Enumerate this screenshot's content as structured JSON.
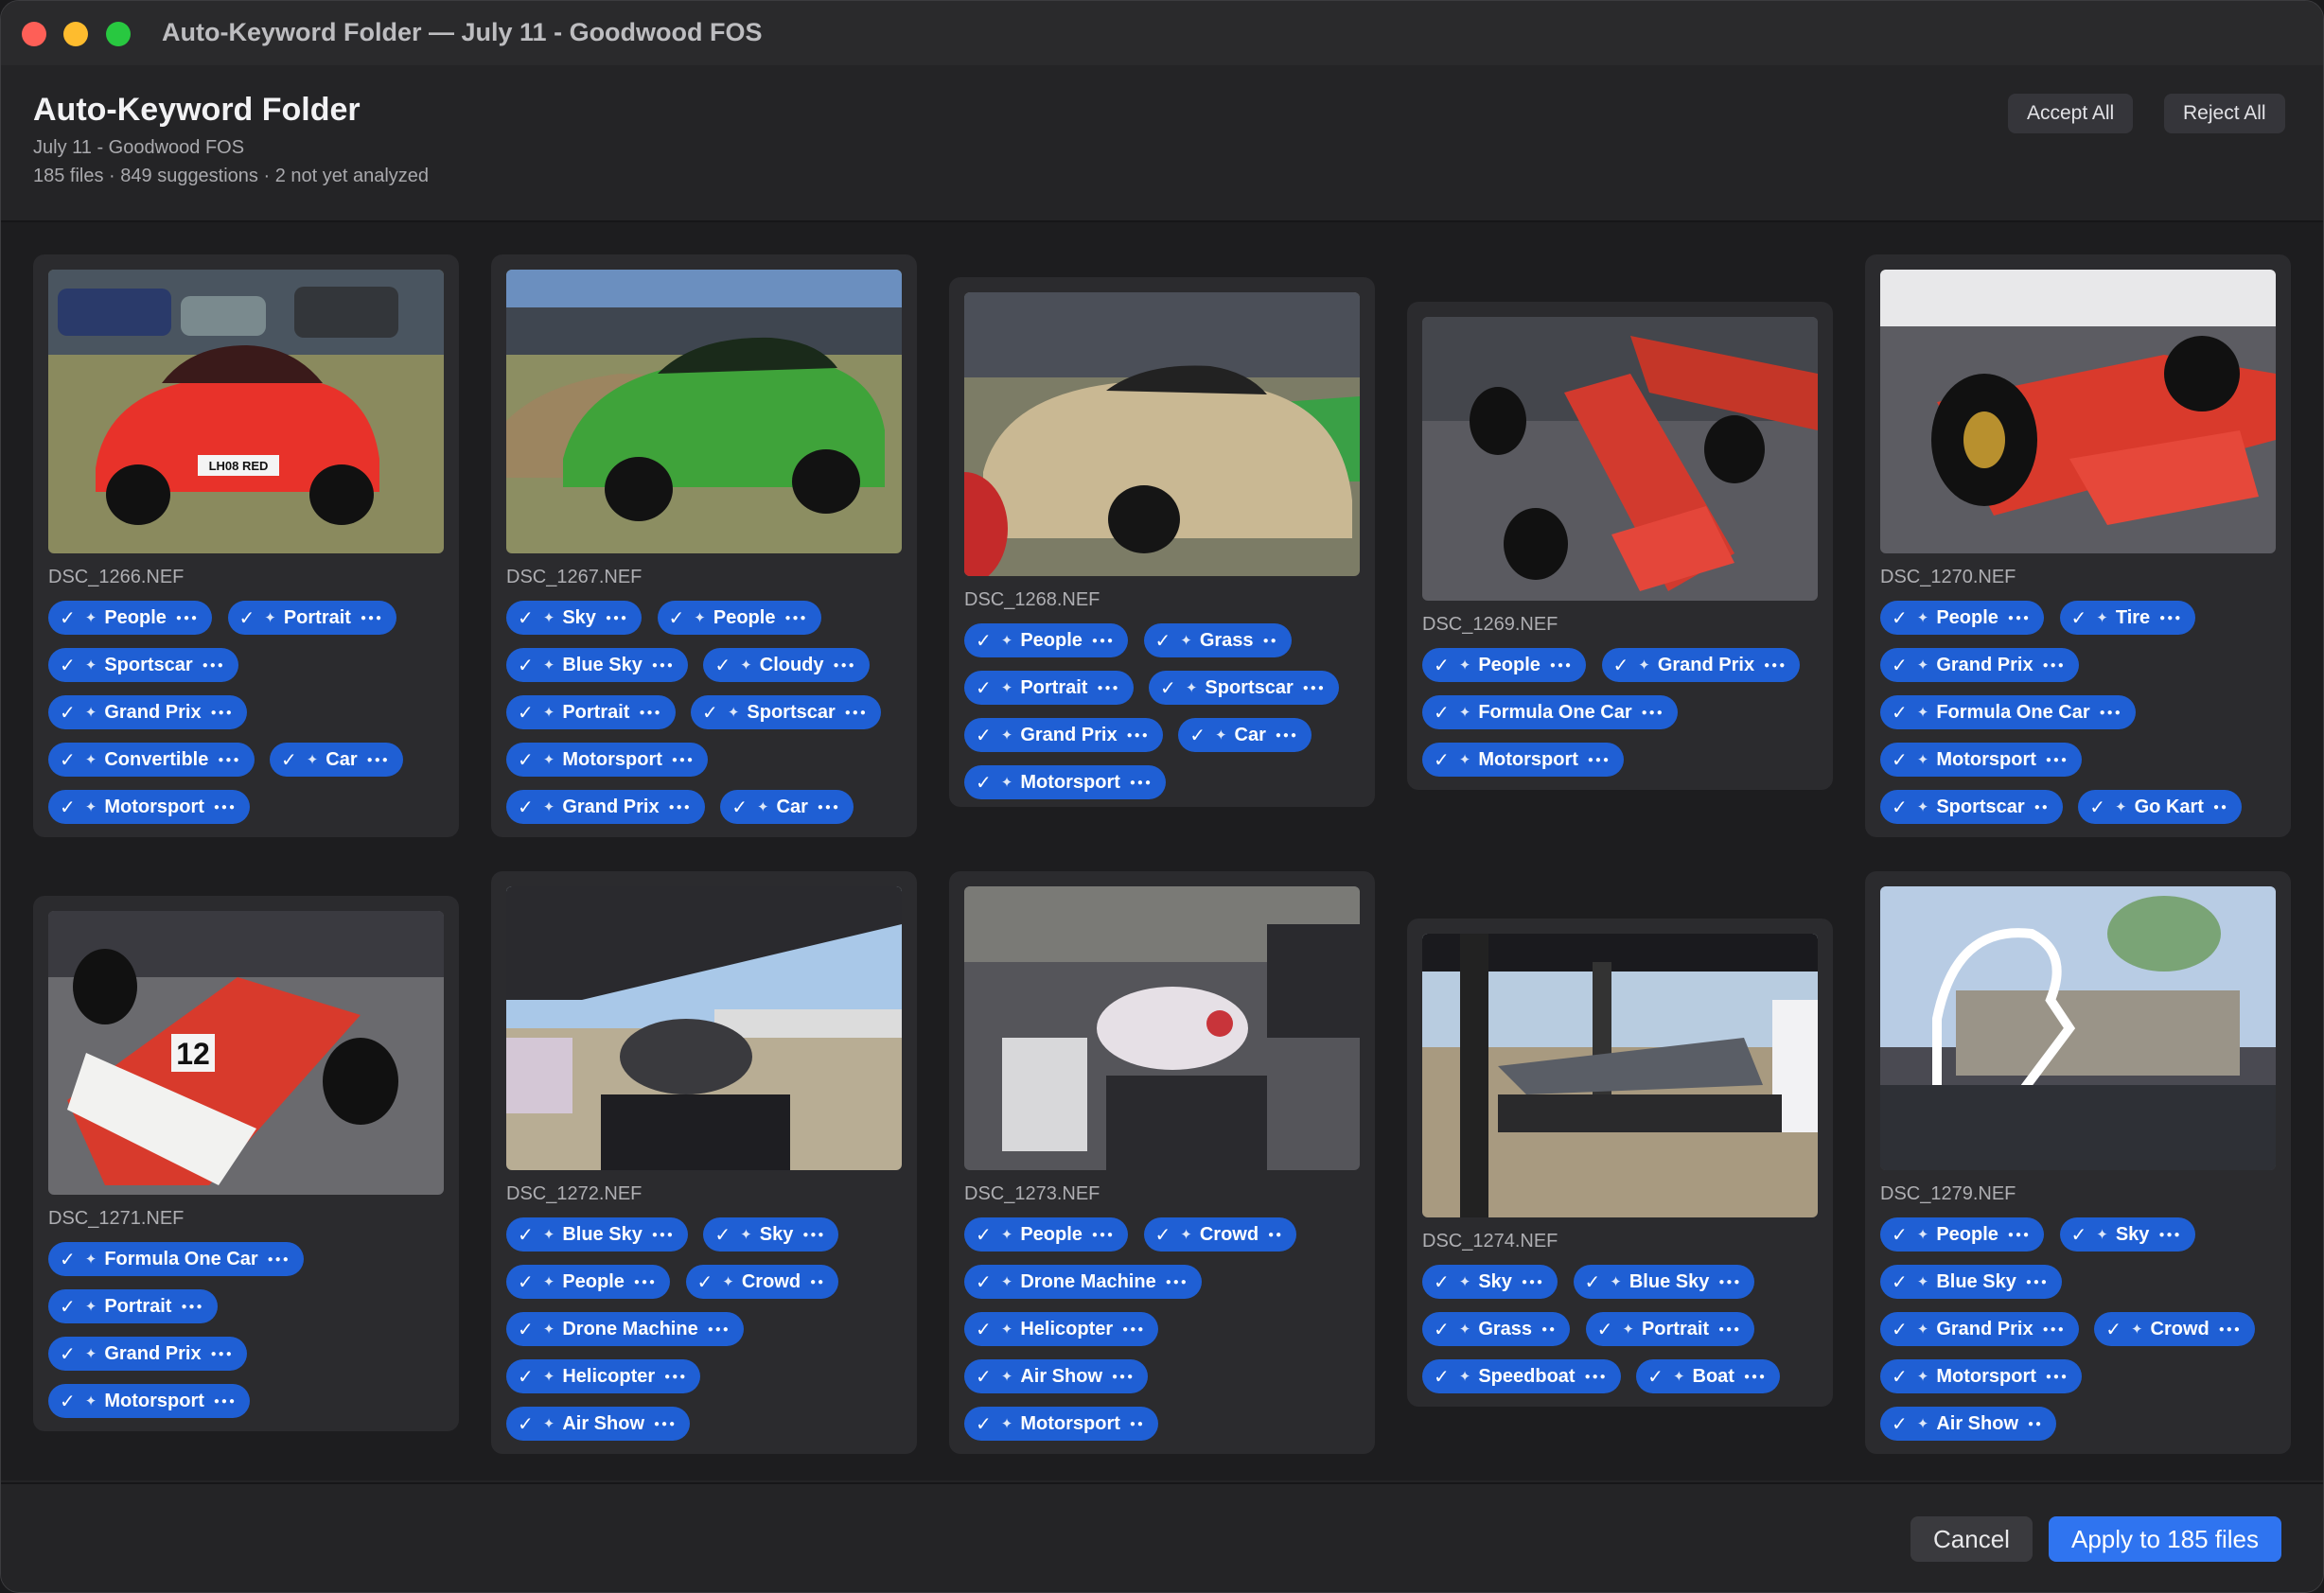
{
  "window": {
    "title": "Auto-Keyword Folder — July 11 - Goodwood FOS"
  },
  "header": {
    "title": "Auto-Keyword Folder",
    "subtitle": "July 11 - Goodwood FOS",
    "meta": "185 files · 849 suggestions · 2 not yet analyzed",
    "accept_all": "Accept All",
    "reject_all": "Reject All"
  },
  "icons": {
    "check": "checkmark-icon",
    "sparkle": "sparkle-icon",
    "more": "ellipsis-icon"
  },
  "cards": [
    {
      "file": "DSC_1266.NEF",
      "tags": [
        "People",
        "Portrait",
        "Sportscar",
        "Grand Prix",
        "Convertible",
        "Car",
        "Motorsport"
      ]
    },
    {
      "file": "DSC_1267.NEF",
      "tags": [
        "Sky",
        "People",
        "Blue Sky",
        "Cloudy",
        "Portrait",
        "Sportscar",
        "Motorsport",
        "Grand Prix",
        "Car"
      ]
    },
    {
      "file": "DSC_1268.NEF",
      "tags": [
        "People",
        "Grass",
        "Portrait",
        "Sportscar",
        "Grand Prix",
        "Car",
        "Motorsport"
      ]
    },
    {
      "file": "DSC_1269.NEF",
      "tags": [
        "People",
        "Grand Prix",
        "Formula One Car",
        "Motorsport"
      ]
    },
    {
      "file": "DSC_1270.NEF",
      "tags": [
        "People",
        "Tire",
        "Grand Prix",
        "Formula One Car",
        "Motorsport",
        "Sportscar",
        "Go Kart"
      ]
    },
    {
      "file": "DSC_1271.NEF",
      "tags": [
        "Formula One Car",
        "Portrait",
        "Grand Prix",
        "Motorsport"
      ]
    },
    {
      "file": "DSC_1272.NEF",
      "tags": [
        "Blue Sky",
        "Sky",
        "People",
        "Crowd",
        "Drone Machine",
        "Helicopter",
        "Air Show"
      ]
    },
    {
      "file": "DSC_1273.NEF",
      "tags": [
        "People",
        "Crowd",
        "Drone Machine",
        "Helicopter",
        "Air Show",
        "Motorsport"
      ]
    },
    {
      "file": "DSC_1274.NEF",
      "tags": [
        "Sky",
        "Blue Sky",
        "Grass",
        "Portrait",
        "Speedboat",
        "Boat"
      ]
    },
    {
      "file": "DSC_1279.NEF",
      "tags": [
        "People",
        "Sky",
        "Blue Sky",
        "Grand Prix",
        "Crowd",
        "Motorsport",
        "Air Show"
      ]
    }
  ],
  "footer": {
    "cancel": "Cancel",
    "apply": "Apply to 185 files"
  }
}
